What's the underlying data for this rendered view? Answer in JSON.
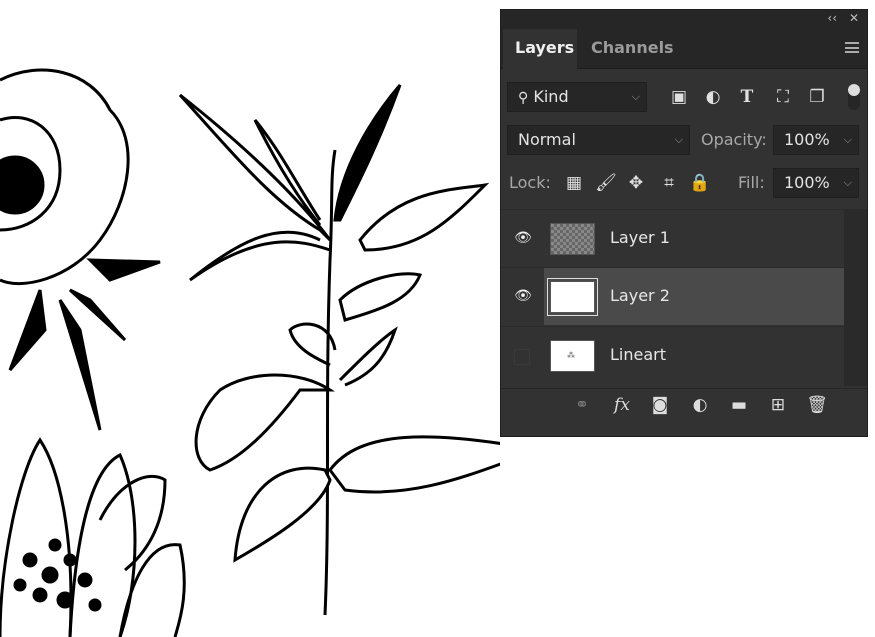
{
  "panel": {
    "controls": {
      "collapse": "‹‹",
      "close": "✕"
    },
    "tabs": [
      {
        "label": "Layers",
        "active": true
      },
      {
        "label": "Channels",
        "active": false
      }
    ],
    "filter": {
      "label": "Kind"
    },
    "blend_mode": "Normal",
    "opacity": {
      "label": "Opacity:",
      "value": "100%"
    },
    "lock": {
      "label": "Lock:"
    },
    "fill": {
      "label": "Fill:",
      "value": "100%"
    },
    "layers": [
      {
        "name": "Layer 1",
        "visible": true,
        "selected": false
      },
      {
        "name": "Layer 2",
        "visible": true,
        "selected": true
      },
      {
        "name": "Lineart",
        "visible": false,
        "selected": false
      }
    ],
    "fx_label": "fx"
  }
}
